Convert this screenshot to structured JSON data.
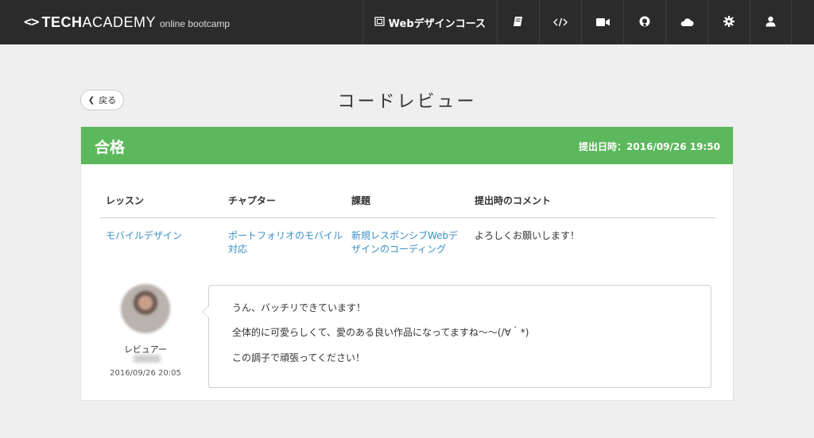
{
  "header": {
    "logo_mark": "<>",
    "logo_tech": "TECH",
    "logo_academy": "ACADEMY",
    "logo_sub": "online bootcamp",
    "course_label": "Webデザインコース",
    "icons": [
      "book-icon",
      "code-icon",
      "video-icon",
      "github-icon",
      "cloud-icon",
      "gear-icon",
      "user-icon"
    ]
  },
  "page": {
    "back_label": "戻る",
    "title": "コードレビュー"
  },
  "card": {
    "status": "合格",
    "submitted_at": "提出日時：2016/09/26 19:50",
    "accent_color": "#5cb85c",
    "table": {
      "headers": [
        "レッスン",
        "チャプター",
        "課題",
        "提出時のコメント"
      ],
      "row": [
        "モバイルデザイン",
        "ポートフォリオのモバイル対応",
        "新規レスポンシブWebデザインのコーディング",
        "よろしくお願いします！"
      ]
    },
    "review": {
      "reviewer_label": "レビュアー",
      "date": "2016/09/26 20:05",
      "lines": [
        "うん、バッチリできています！",
        "全体的に可愛らしくて、愛のある良い作品になってますね〜〜(/∀｀*)",
        "この調子で頑張ってください！"
      ]
    }
  }
}
